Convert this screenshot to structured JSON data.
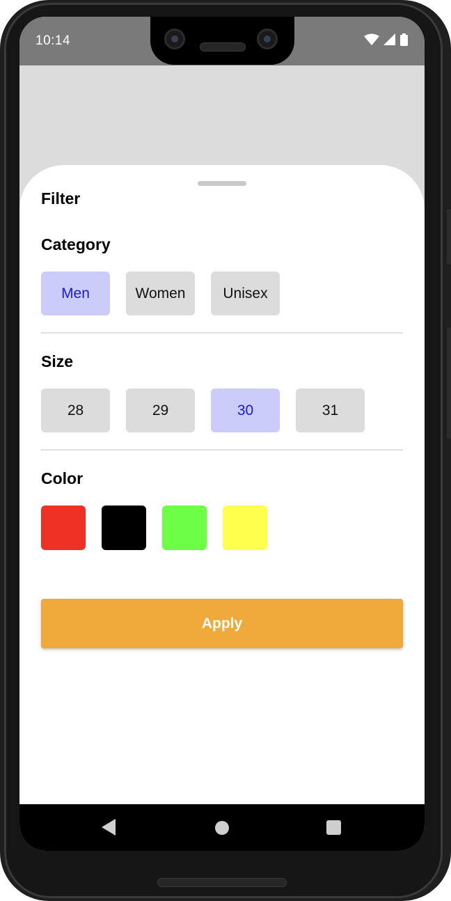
{
  "status_bar": {
    "time": "10:14",
    "icons": [
      "wifi-icon",
      "signal-icon",
      "battery-icon"
    ]
  },
  "sheet": {
    "title": "Filter"
  },
  "category": {
    "title": "Category",
    "options": [
      "Men",
      "Women",
      "Unisex"
    ],
    "selected": "Men"
  },
  "size": {
    "title": "Size",
    "options": [
      "28",
      "29",
      "30",
      "31"
    ],
    "selected": "30"
  },
  "color": {
    "title": "Color",
    "swatches": [
      "#ee3124",
      "#000000",
      "#6cff45",
      "#ffff4d"
    ]
  },
  "apply_label": "Apply",
  "navigation": {
    "icons": [
      "back-icon",
      "home-icon",
      "recents-icon"
    ]
  },
  "colors": {
    "accent": "#f0a93b",
    "chip_selected_bg": "#ccccfa",
    "chip_selected_text": "#1a1adb",
    "chip_bg": "#dcdcdc"
  }
}
